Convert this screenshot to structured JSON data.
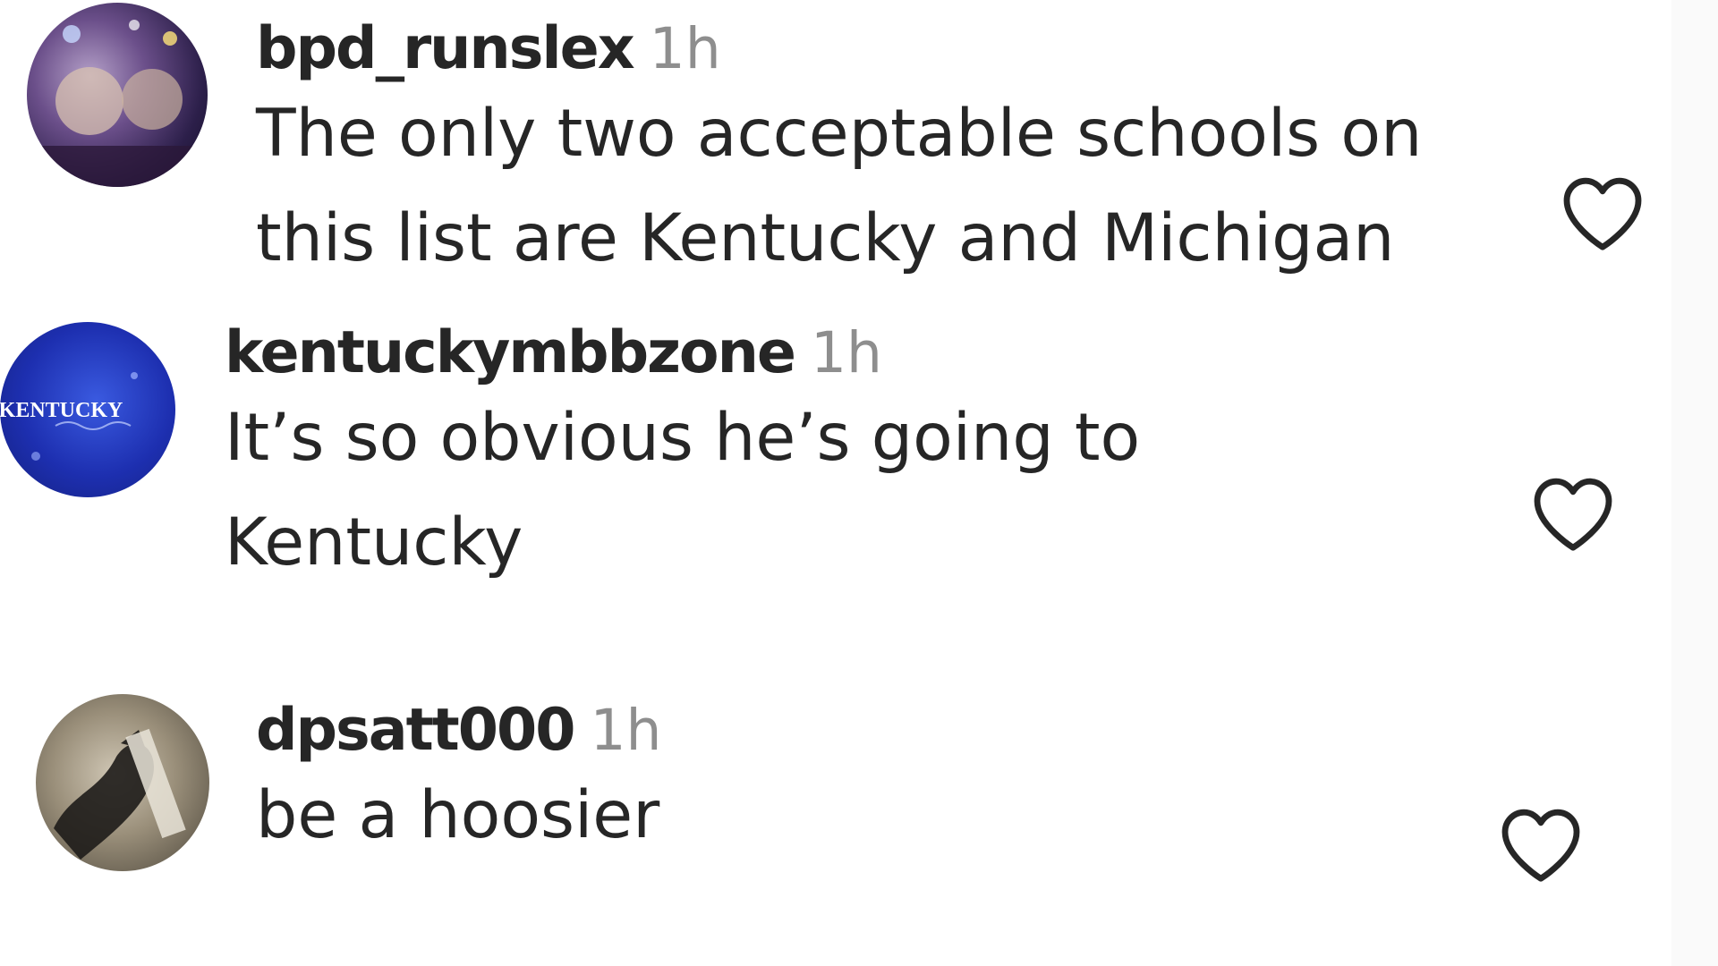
{
  "comments": [
    {
      "username": "bpd_runslex",
      "time": "1h",
      "lines": [
        "The only two acceptable schools on",
        "this list are Kentucky and Michigan"
      ],
      "avatar": "profile-photo",
      "like_icon": "heart-icon"
    },
    {
      "username": "kentuckymbbzone",
      "time": "1h",
      "lines": [
        "It’s so obvious he’s going to",
        "Kentucky"
      ],
      "avatar": "kentucky-logo",
      "avatar_text": "KENTUCKY",
      "like_icon": "heart-icon"
    },
    {
      "username": "dpsatt000",
      "time": "1h",
      "lines": [
        "be a hoosier"
      ],
      "avatar": "profile-photo",
      "like_icon": "heart-icon"
    }
  ],
  "colors": {
    "text": "#262626",
    "muted": "#8e8e8e",
    "kentucky_blue": "#1d2fb0"
  }
}
